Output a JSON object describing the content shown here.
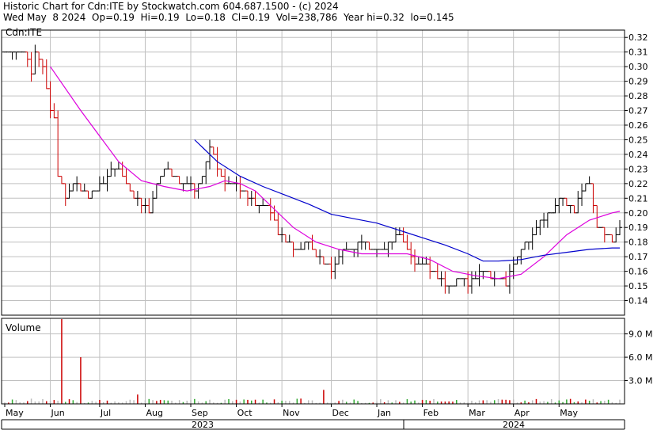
{
  "header": {
    "title": "Historic Chart for Cdn:ITE by Stockwatch.com 604.687.1500 - (c) 2024",
    "date": "Wed May  8 2024",
    "open": "Op=0.19",
    "high": "Hi=0.19",
    "low": "Lo=0.18",
    "close": "Cl=0.19",
    "volume": "Vol=238,786",
    "year_high": "Year hi=0.32",
    "year_low": "lo=0.145"
  },
  "price_panel": {
    "symbol_label": "Cdn:ITE"
  },
  "volume_panel": {
    "label": "Volume"
  },
  "colors": {
    "up_bar": "#000000",
    "down_bar": "#cc0000",
    "short_ma": "#dd00dd",
    "long_ma": "#0000cc",
    "grid": "#c0c0c0",
    "volume_bar": "#bbbbbb"
  },
  "chart_data": [
    {
      "type": "ohlc",
      "ylim": [
        0.13,
        0.325
      ],
      "y_ticks": [
        "0.32",
        "0.31",
        "0.30",
        "0.29",
        "0.28",
        "0.27",
        "0.26",
        "0.25",
        "0.24",
        "0.23",
        "0.22",
        "0.21",
        "0.20",
        "0.19",
        "0.18",
        "0.17",
        "0.16",
        "0.15",
        "0.14"
      ],
      "x_months": [
        "May",
        "Jun",
        "Jul",
        "Aug",
        "Sep",
        "Oct",
        "Nov",
        "Dec",
        "Jan",
        "Feb",
        "Mar",
        "Apr",
        "May"
      ],
      "x_years": [
        "2023",
        "2024"
      ],
      "close_path": [
        [
          0,
          0.31
        ],
        [
          4,
          0.31
        ],
        [
          6,
          0.305
        ],
        [
          7,
          0.295
        ],
        [
          8,
          0.31
        ],
        [
          10,
          0.3
        ],
        [
          11,
          0.285
        ],
        [
          12,
          0.27
        ],
        [
          13,
          0.265
        ],
        [
          14,
          0.225
        ],
        [
          16,
          0.21
        ],
        [
          18,
          0.22
        ],
        [
          20,
          0.215
        ],
        [
          22,
          0.21
        ],
        [
          24,
          0.215
        ],
        [
          26,
          0.22
        ],
        [
          28,
          0.23
        ],
        [
          30,
          0.23
        ],
        [
          32,
          0.22
        ],
        [
          34,
          0.21
        ],
        [
          36,
          0.205
        ],
        [
          38,
          0.2
        ],
        [
          40,
          0.22
        ],
        [
          42,
          0.23
        ],
        [
          44,
          0.225
        ],
        [
          46,
          0.22
        ],
        [
          48,
          0.22
        ],
        [
          50,
          0.215
        ],
        [
          52,
          0.225
        ],
        [
          54,
          0.245
        ],
        [
          56,
          0.23
        ],
        [
          58,
          0.22
        ],
        [
          60,
          0.22
        ],
        [
          62,
          0.215
        ],
        [
          64,
          0.21
        ],
        [
          66,
          0.205
        ],
        [
          68,
          0.205
        ],
        [
          70,
          0.2
        ],
        [
          72,
          0.185
        ],
        [
          74,
          0.18
        ],
        [
          76,
          0.175
        ],
        [
          78,
          0.175
        ],
        [
          80,
          0.18
        ],
        [
          82,
          0.17
        ],
        [
          84,
          0.165
        ],
        [
          86,
          0.16
        ],
        [
          88,
          0.17
        ],
        [
          90,
          0.175
        ],
        [
          92,
          0.175
        ],
        [
          94,
          0.18
        ],
        [
          96,
          0.175
        ],
        [
          98,
          0.175
        ],
        [
          100,
          0.175
        ],
        [
          102,
          0.18
        ],
        [
          104,
          0.185
        ],
        [
          106,
          0.175
        ],
        [
          108,
          0.165
        ],
        [
          110,
          0.165
        ],
        [
          112,
          0.16
        ],
        [
          114,
          0.155
        ],
        [
          116,
          0.15
        ],
        [
          118,
          0.15
        ],
        [
          120,
          0.155
        ],
        [
          122,
          0.15
        ],
        [
          124,
          0.155
        ],
        [
          126,
          0.16
        ],
        [
          128,
          0.155
        ],
        [
          130,
          0.155
        ],
        [
          132,
          0.15
        ],
        [
          134,
          0.165
        ],
        [
          136,
          0.175
        ],
        [
          138,
          0.18
        ],
        [
          140,
          0.19
        ],
        [
          142,
          0.195
        ],
        [
          144,
          0.2
        ],
        [
          146,
          0.21
        ],
        [
          148,
          0.205
        ],
        [
          150,
          0.2
        ],
        [
          152,
          0.215
        ],
        [
          154,
          0.22
        ],
        [
          156,
          0.19
        ],
        [
          158,
          0.185
        ],
        [
          160,
          0.18
        ],
        [
          162,
          0.19
        ]
      ],
      "x_range": [
        0,
        162
      ],
      "x_month_positions": [
        0,
        12,
        25,
        37,
        49,
        61,
        73,
        86,
        98,
        110,
        122,
        134,
        146
      ],
      "short_ma": [
        [
          12,
          0.3
        ],
        [
          20,
          0.27
        ],
        [
          30,
          0.235
        ],
        [
          36,
          0.222
        ],
        [
          42,
          0.218
        ],
        [
          48,
          0.215
        ],
        [
          54,
          0.218
        ],
        [
          58,
          0.222
        ],
        [
          62,
          0.22
        ],
        [
          66,
          0.215
        ],
        [
          70,
          0.205
        ],
        [
          76,
          0.19
        ],
        [
          82,
          0.18
        ],
        [
          88,
          0.175
        ],
        [
          94,
          0.172
        ],
        [
          100,
          0.172
        ],
        [
          106,
          0.172
        ],
        [
          112,
          0.168
        ],
        [
          118,
          0.16
        ],
        [
          124,
          0.157
        ],
        [
          130,
          0.155
        ],
        [
          136,
          0.158
        ],
        [
          142,
          0.17
        ],
        [
          148,
          0.185
        ],
        [
          154,
          0.195
        ],
        [
          160,
          0.2
        ],
        [
          162,
          0.201
        ]
      ],
      "long_ma": [
        [
          50,
          0.25
        ],
        [
          56,
          0.235
        ],
        [
          62,
          0.225
        ],
        [
          68,
          0.218
        ],
        [
          74,
          0.212
        ],
        [
          80,
          0.206
        ],
        [
          86,
          0.199
        ],
        [
          92,
          0.196
        ],
        [
          98,
          0.193
        ],
        [
          104,
          0.188
        ],
        [
          110,
          0.183
        ],
        [
          116,
          0.178
        ],
        [
          122,
          0.172
        ],
        [
          126,
          0.167
        ],
        [
          130,
          0.167
        ],
        [
          136,
          0.168
        ],
        [
          142,
          0.171
        ],
        [
          148,
          0.173
        ],
        [
          154,
          0.175
        ],
        [
          160,
          0.176
        ],
        [
          162,
          0.176
        ]
      ]
    },
    {
      "type": "bar",
      "name": "Volume",
      "ylim": [
        0,
        11000000
      ],
      "y_ticks": [
        "9.0 M",
        "6.0 M",
        "3.0 M"
      ],
      "spikes": [
        [
          15,
          10900000
        ],
        [
          20,
          6000000
        ],
        [
          84,
          1800000
        ],
        [
          35,
          1200000
        ]
      ],
      "base_volume": 400000
    }
  ]
}
